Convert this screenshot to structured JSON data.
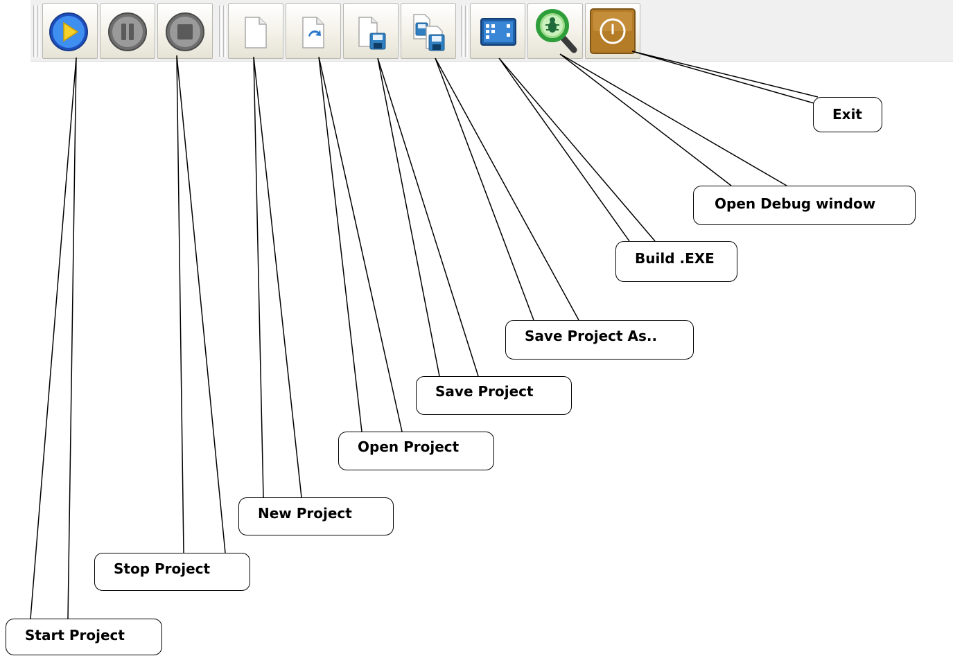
{
  "toolbar": {
    "buttons": [
      {
        "icon": "play-icon"
      },
      {
        "icon": "pause-icon"
      },
      {
        "icon": "stop-icon"
      },
      {
        "icon": "new-file-icon"
      },
      {
        "icon": "open-file-icon"
      },
      {
        "icon": "save-file-icon"
      },
      {
        "icon": "save-as-icon"
      },
      {
        "icon": "build-exe-icon"
      },
      {
        "icon": "debug-magnifier-icon"
      },
      {
        "icon": "power-exit-icon"
      }
    ]
  },
  "callouts": {
    "start": "Start Project",
    "stop": "Stop Project",
    "new": "New Project",
    "open": "Open Project",
    "save": "Save Project",
    "save_as": "Save Project As..",
    "build": "Build .EXE",
    "debug": "Open Debug window",
    "exit": "Exit"
  },
  "colors": {
    "toolbar_bg": "#f0f0f0",
    "play_blue": "#2b6fe0",
    "play_yellow": "#f7d12a",
    "button_gray": "#8a8a8a",
    "debug_green": "#2e9e3a",
    "exit_brown": "#b07a2a"
  }
}
